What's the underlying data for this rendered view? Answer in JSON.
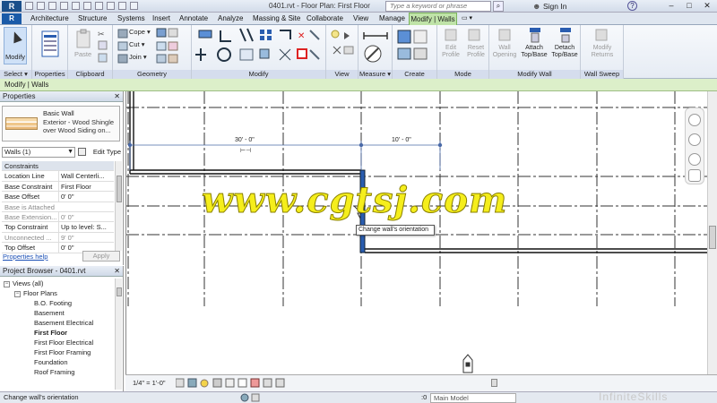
{
  "title_bar": {
    "app_icon": "R",
    "doc_title": "0401.rvt - Floor Plan: First Floor",
    "search_placeholder": "Type a keyword or phrase",
    "sign_in": "Sign In",
    "help": "?",
    "minimize": "–",
    "restore": "□",
    "close": "✕"
  },
  "tabs": {
    "file": "R",
    "items": [
      "Architecture",
      "Structure",
      "Systems",
      "Insert",
      "Annotate",
      "Analyze",
      "Massing & Site",
      "Collaborate",
      "View",
      "Manage"
    ],
    "contextual": "Modify | Walls"
  },
  "ribbon": {
    "select_button": "Modify",
    "panels": {
      "select": "Select ▾",
      "properties": "Properties",
      "clipboard": "Clipboard",
      "geometry": "Geometry",
      "modify": "Modify",
      "view": "View",
      "measure": "Measure ▾",
      "create": "Create",
      "mode": "Mode",
      "modify_wall": "Modify Wall",
      "wall_sweep": "Wall Sweep"
    },
    "clipboard_paste": "Paste",
    "geometry_items": [
      "Cope ▾",
      "Cut ▾",
      "Join ▾"
    ],
    "mode_buttons": [
      "Edit Profile",
      "Reset Profile"
    ],
    "modify_wall_buttons": [
      "Wall Opening",
      "Attach Top/Base",
      "Detach Top/Base"
    ],
    "wall_sweep_button": "Modify Returns"
  },
  "context_bar": "Modify | Walls",
  "properties": {
    "header": "Properties",
    "type_name": "Basic Wall",
    "type_desc": "Exterior - Wood Shingle over Wood Siding on...",
    "instance": "Walls (1)",
    "edit_type": "Edit Type",
    "rows": [
      {
        "k": "Constraints",
        "v": "",
        "group": true
      },
      {
        "k": "Location Line",
        "v": "Wall Centerli..."
      },
      {
        "k": "Base Constraint",
        "v": "First Floor"
      },
      {
        "k": "Base Offset",
        "v": "0' 0\""
      },
      {
        "k": "Base is Attached",
        "v": "",
        "dim": true
      },
      {
        "k": "Base Extension...",
        "v": "0' 0\"",
        "dim": true
      },
      {
        "k": "Top Constraint",
        "v": "Up to level: S..."
      },
      {
        "k": "Unconnected ...",
        "v": "9' 0\"",
        "dim": true
      },
      {
        "k": "Top Offset",
        "v": "0' 0\""
      }
    ],
    "help_link": "Properties help",
    "apply": "Apply"
  },
  "browser": {
    "header": "Project Browser - 0401.rvt",
    "items": [
      {
        "label": "Views (all)",
        "level": 0,
        "exp": "−",
        "bold": false
      },
      {
        "label": "Floor Plans",
        "level": 1,
        "exp": "−",
        "bold": false
      },
      {
        "label": "B.O. Footing",
        "level": 2,
        "bold": false
      },
      {
        "label": "Basement",
        "level": 2,
        "bold": false
      },
      {
        "label": "Basement Electrical",
        "level": 2,
        "bold": false
      },
      {
        "label": "First Floor",
        "level": 2,
        "bold": true
      },
      {
        "label": "First Floor Electrical",
        "level": 2,
        "bold": false
      },
      {
        "label": "First Floor Framing",
        "level": 2,
        "bold": false
      },
      {
        "label": "Foundation",
        "level": 2,
        "bold": false
      },
      {
        "label": "Roof Framing",
        "level": 2,
        "bold": false
      }
    ]
  },
  "canvas": {
    "dim_left": "30' - 0\"",
    "dim_right": "10' - 0\"",
    "tooltip": "Change wall's orientation",
    "watermark": "www.cgtsj.com"
  },
  "view_control": {
    "scale": "1/4\" = 1'-0\""
  },
  "status": {
    "text": "Change wall's orientation",
    "zero": ":0",
    "model": "Main Model",
    "brand": "InfiniteSkills"
  },
  "colors": {
    "accent": "#2a5db0",
    "context_green": "#bfe3a8",
    "watermark": "#f5ee1c"
  }
}
